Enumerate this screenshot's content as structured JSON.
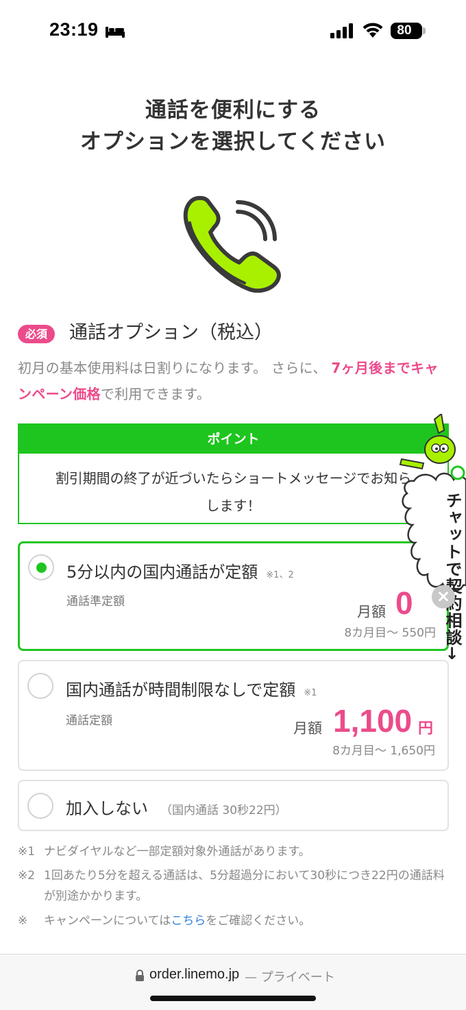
{
  "status_bar": {
    "time": "23:19",
    "battery": "80",
    "icons": [
      "bed-icon",
      "signal-icon",
      "wifi-icon",
      "battery-icon"
    ]
  },
  "heading": {
    "line1": "通話を便利にする",
    "line2": "オプションを選択してください"
  },
  "section": {
    "badge": "必須",
    "title": "通話オプション（税込）",
    "intro_plain1": "初月の基本使用料は日割りになります。 さらに、",
    "intro_highlight1": "7ヶ月後まで",
    "intro_highlight2": "キャンペーン価格",
    "intro_plain2": "で利用できます。"
  },
  "point": {
    "header": "ポイント",
    "line1": "割引期間の終了が近づいたらショートメッセージでお知ら",
    "line2": "します！"
  },
  "options": [
    {
      "title": "5分以内の国内通話が定額",
      "note": "※1、2",
      "sub": "通話準定額",
      "price_label": "月額",
      "price": "0",
      "unit": "円",
      "after": "8カ月目〜 550円",
      "selected": true
    },
    {
      "title": "国内通話が時間制限なしで定額",
      "note": "※1",
      "sub": "通話定額",
      "price_label": "月額",
      "price": "1,100",
      "unit": "円",
      "after": "8カ月目〜 1,650円",
      "selected": false
    },
    {
      "title": "加入しない",
      "extra": "（国内通話 30秒22円）",
      "selected": false
    }
  ],
  "footnotes": [
    {
      "mark": "※1",
      "text": "ナビダイヤルなど一部定額対象外通話があります。"
    },
    {
      "mark": "※2",
      "text": "1回あたり5分を超える通話は、5分超過分において30秒につき22円の通話料が別途かかります。"
    },
    {
      "mark": "※",
      "text_before": "キャンペーンについては",
      "link": "こちら",
      "text_after": "をご確認ください。"
    }
  ],
  "chat": {
    "label": "チャットで契約相談→"
  },
  "url_bar": {
    "url": "order.linemo.jp",
    "suffix": "— プライベート"
  },
  "colors": {
    "brand_green": "#1fc51f",
    "accent_pink": "#ec4b8b",
    "link_blue": "#2f7fd8",
    "phone_green": "#a8f000"
  }
}
